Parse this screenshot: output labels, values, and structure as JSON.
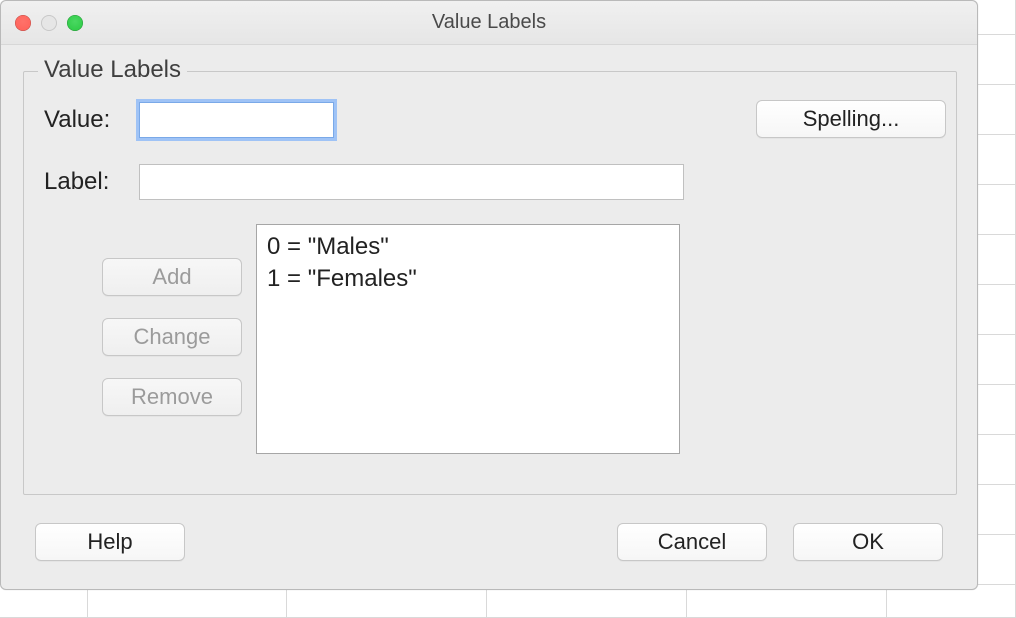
{
  "window": {
    "title": "Value Labels"
  },
  "group": {
    "legend": "Value Labels",
    "value_label": "Value:",
    "label_label": "Label:",
    "value_input": "",
    "label_input": "",
    "spelling_button": "Spelling...",
    "actions": {
      "add": "Add",
      "change": "Change",
      "remove": "Remove"
    },
    "entries": [
      "0 = \"Males\"",
      "1 = \"Females\""
    ]
  },
  "bottom": {
    "help": "Help",
    "cancel": "Cancel",
    "ok": "OK"
  }
}
